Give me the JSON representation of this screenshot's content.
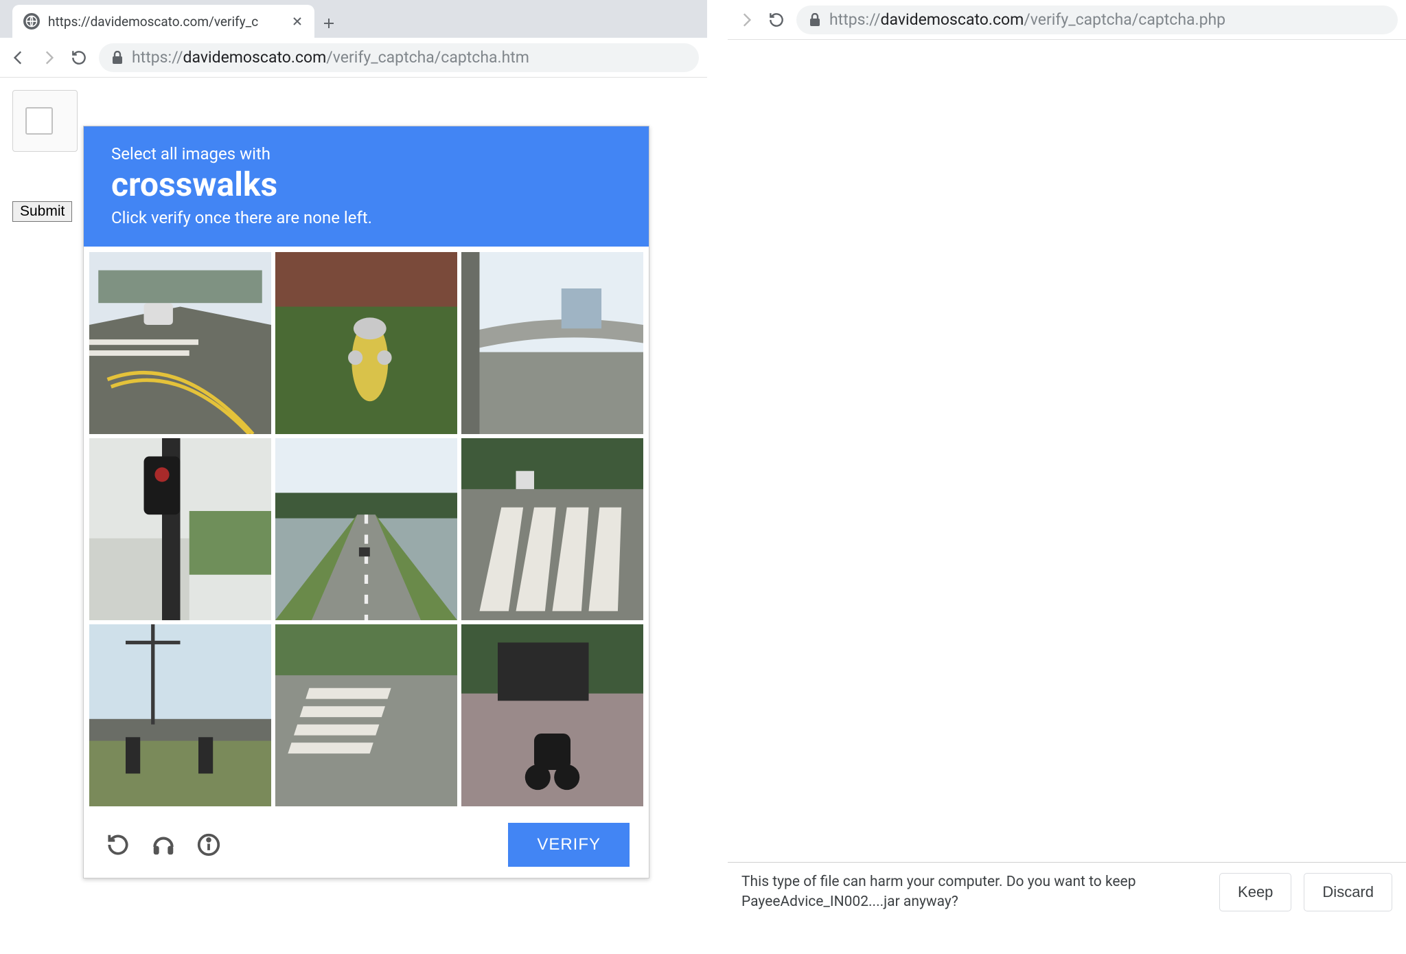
{
  "left_window": {
    "tab_title": "https://davidemoscato.com/verify_c",
    "url_prefix": "https://",
    "url_domain": "davidemoscato.com",
    "url_path": "/verify_captcha/captcha.htm",
    "submit_label": "Submit"
  },
  "right_window": {
    "url_prefix": "https://",
    "url_domain": "davidemoscato.com",
    "url_path": "/verify_captcha/captcha.php"
  },
  "captcha": {
    "instruction_line1": "Select all images with",
    "target": "crosswalks",
    "instruction_line2": "Click verify once there are none left.",
    "verify_label": "VERIFY",
    "tiles": [
      "street-crosswalk-car",
      "fire-hydrant-grass",
      "highway-overpass",
      "traffic-light-pole",
      "highway-lanes",
      "zebra-crosswalk",
      "bridge-powerlines",
      "sidewalk-crosswalk",
      "scooter-sidewalk"
    ]
  },
  "download_bar": {
    "message": "This type of file can harm your computer. Do you want to keep PayeeAdvice_IN002....jar anyway?",
    "keep_label": "Keep",
    "discard_label": "Discard"
  }
}
